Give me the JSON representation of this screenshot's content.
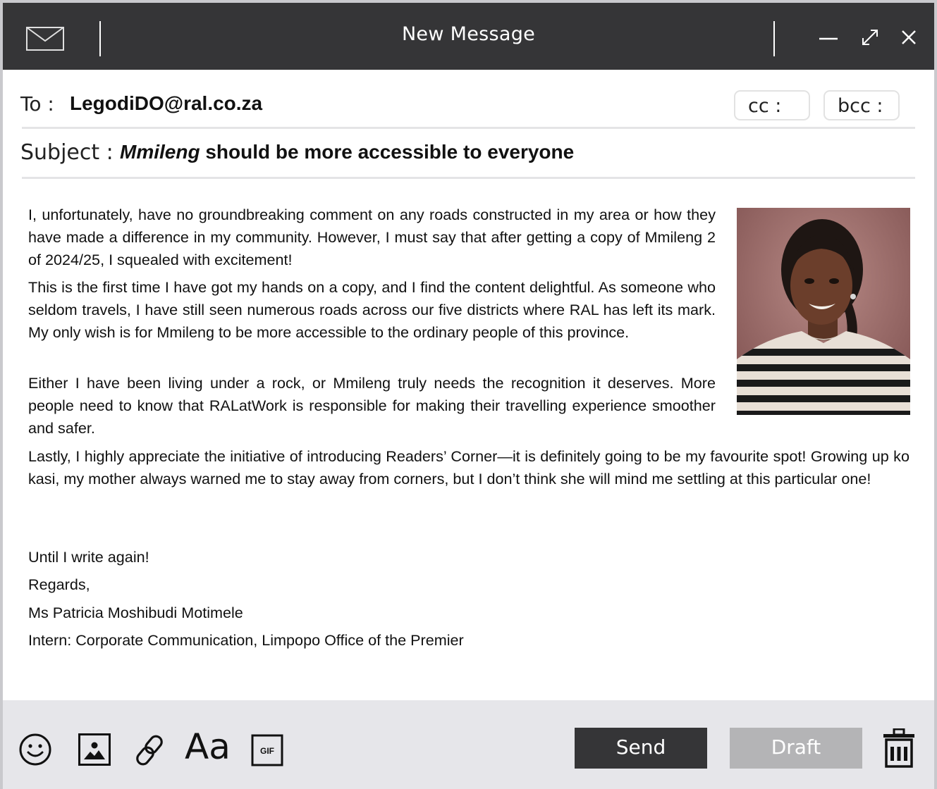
{
  "window": {
    "title": "New Message",
    "icons": {
      "app": "mail-icon",
      "minimize": "minimize-icon",
      "maximize": "maximize-icon",
      "close": "close-icon"
    }
  },
  "header": {
    "to_label": "To :",
    "to_value": "LegodiDO@ral.co.za",
    "cc_label": "cc :",
    "bcc_label": "bcc :",
    "subject_label": "Subject :",
    "subject_emphasis": "Mmileng",
    "subject_rest": " should be more accessible to everyone"
  },
  "body": {
    "paragraphs": [
      "I, unfortunately, have no groundbreaking comment on any roads constructed in my area or how they have made a difference in my community. However, I must say that after getting a copy of Mmileng 2 of 2024/25, I squealed with excitement!",
      "This is the first time I have got my hands on a copy, and I find the content delightful. As someone who seldom travels, I have still seen numerous roads across our five districts where RAL has left its mark. My only wish is for Mmileng to be more accessible to the ordinary people of this province.",
      "Either I have been living under a rock, or Mmileng truly needs the recognition it deserves. More people need to know that RALatWork is responsible for making their travelling experience smoother and safer.",
      "Lastly, I highly appreciate the initiative of introducing Readers’ Corner—it is definitely going to be my favourite spot! Growing up ko kasi, my mother always warned me to stay away from corners, but I don’t think she will mind me settling at this particular one!"
    ],
    "signoff": [
      "Until I write again!",
      "Regards,",
      "Ms Patricia Moshibudi Motimele",
      "Intern: Corporate Communication, Limpopo Office of the Premier"
    ],
    "photo": "author-photo"
  },
  "toolbar": {
    "tools": [
      "emoji-icon",
      "image-icon",
      "link-icon",
      "font-icon",
      "gif-icon",
      "trash-icon"
    ],
    "font_label": "Aa",
    "gif_label": "GIF",
    "send_label": "Send",
    "draft_label": "Draft"
  },
  "colors": {
    "titlebar": "#353537",
    "footer": "#e6e6ea",
    "send_button": "#353537",
    "draft_button": "#b4b4b6"
  }
}
